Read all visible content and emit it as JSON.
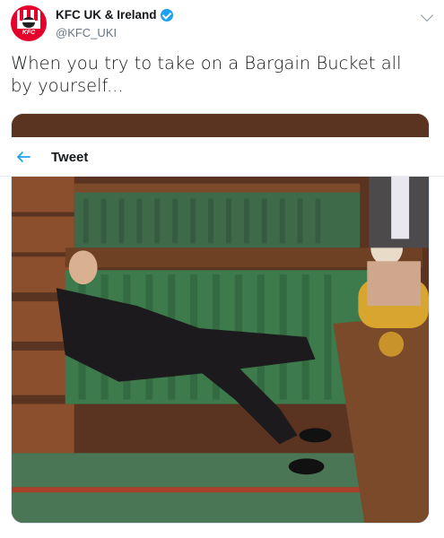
{
  "account": {
    "display_name": "KFC UK & Ireland",
    "handle": "@KFC_UKI",
    "verified": true,
    "avatar_logo_text": "KFC"
  },
  "tweet": {
    "text": "When you try to take on a Bargain Bucket all by yourself..."
  },
  "overlay": {
    "title": "Tweet"
  },
  "colors": {
    "brand_red": "#e4002b",
    "verified_blue": "#1da1f2",
    "accent_blue": "#1da1f2",
    "handle_gray": "#657786"
  },
  "icons": [
    "verified-badge-icon",
    "chevron-down-icon",
    "back-arrow-icon"
  ]
}
